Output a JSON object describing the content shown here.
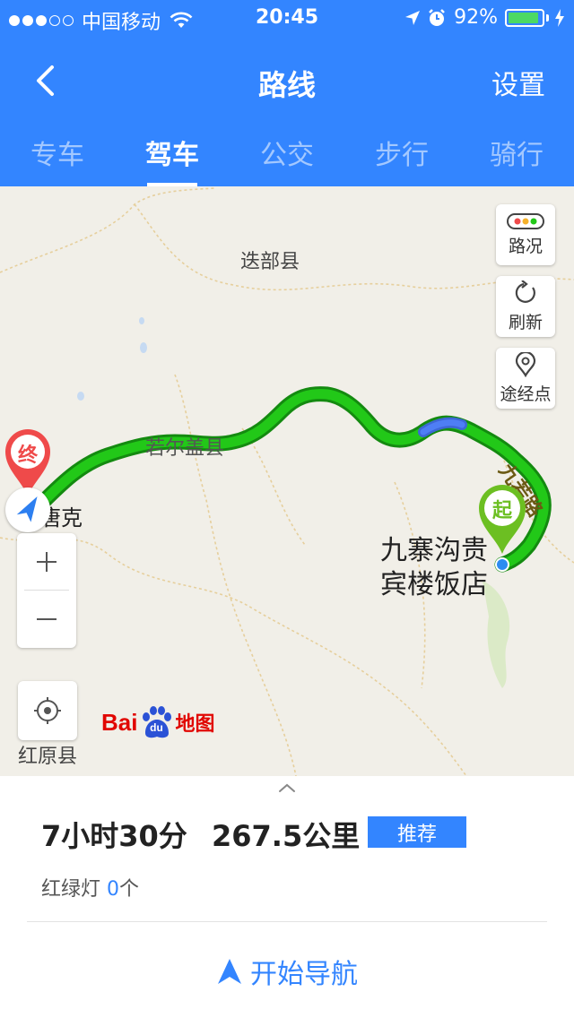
{
  "status_bar": {
    "carrier": "中国移动",
    "time": "20:45",
    "battery": "92%",
    "battery_level": 0.92,
    "signal_bars_filled": 3,
    "signal_bars_total": 5
  },
  "nav": {
    "title": "路线",
    "settings_label": "设置"
  },
  "tabs": [
    {
      "label": "专车",
      "active": false
    },
    {
      "label": "驾车",
      "active": true
    },
    {
      "label": "公交",
      "active": false
    },
    {
      "label": "步行",
      "active": false
    },
    {
      "label": "骑行",
      "active": false
    }
  ],
  "map": {
    "labels": {
      "diebu": "迭部县",
      "ruoergai": "若尔盖县",
      "tangke": "唐克",
      "hongyuan": "红原县",
      "jiuzhai_line1": "九寨沟贵",
      "jiuzhai_line2": "宾楼饭店",
      "road": "九若路"
    },
    "start_marker": "起",
    "end_marker": "终",
    "controls": {
      "traffic": "路况",
      "refresh": "刷新",
      "waypoint": "途经点"
    },
    "logo": {
      "bai": "Bai",
      "du": "du",
      "ditu": "地图"
    },
    "colors": {
      "route": "#22c818",
      "route_slow": "#4e7ef5",
      "start": "#6cbf22",
      "end": "#ef4a4a"
    }
  },
  "summary": {
    "duration": "7小时30分",
    "distance": "267.5公里",
    "badge": "推荐",
    "lights_label": "红绿灯",
    "lights_count": "0",
    "lights_unit": "个",
    "start_nav": "开始导航"
  }
}
